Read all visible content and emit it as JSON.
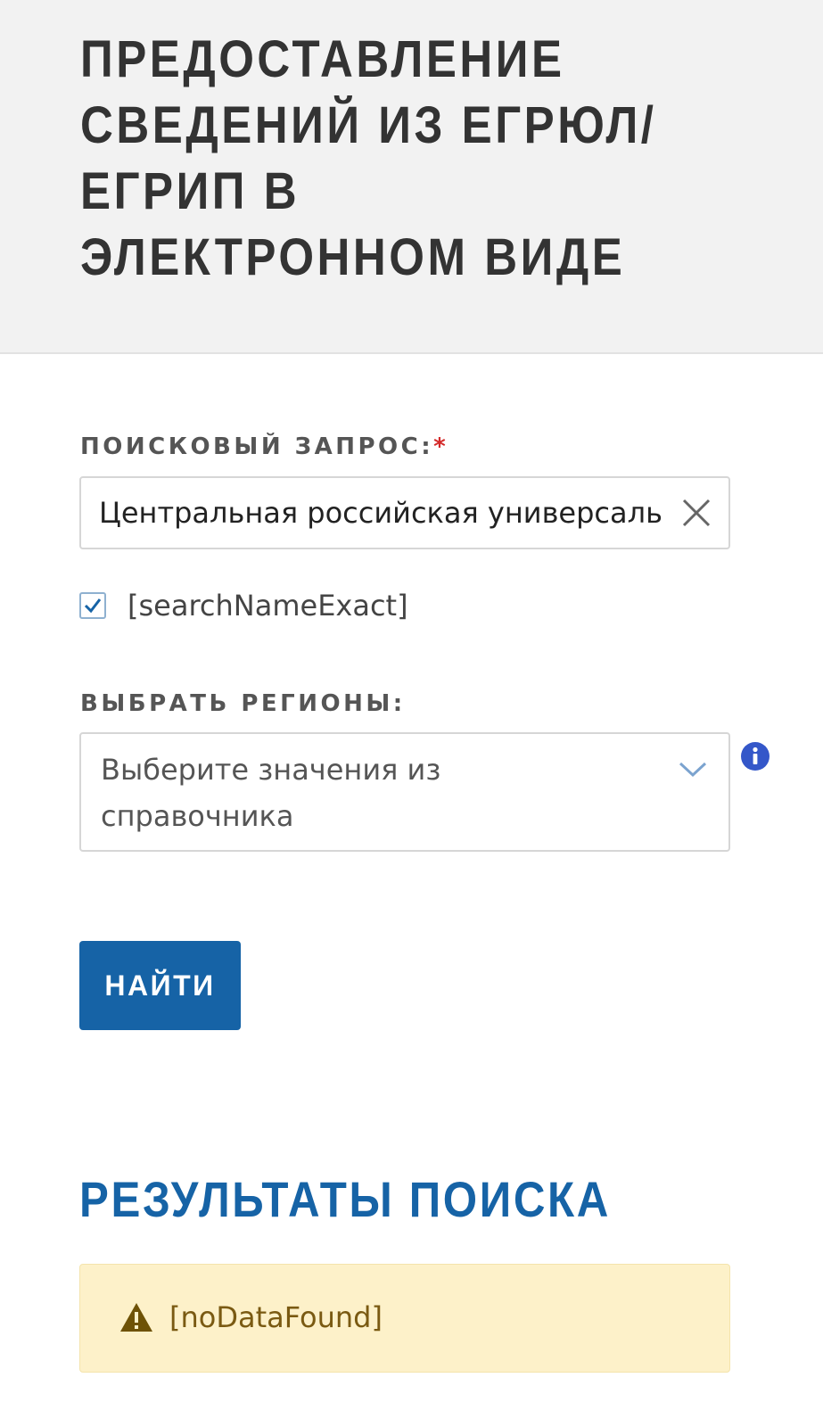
{
  "header": {
    "title": "Предоставление сведений из ЕГРЮЛ/ ЕГРИП в электронном виде"
  },
  "form": {
    "query_label": "Поисковый запрос:",
    "query_required_mark": "*",
    "query_value": "Центральная российская универсаль",
    "exact_checkbox_label": "[searchNameExact]",
    "exact_checked": true,
    "regions_label": "Выбрать регионы:",
    "regions_placeholder": "Выберите значения из справочника",
    "search_button": "Найти"
  },
  "results": {
    "title": "Результаты поиска",
    "message": "[noDataFound]"
  },
  "icons": {
    "clear": "close-icon",
    "checkbox": "check-icon",
    "dropdown": "chevron-down-icon",
    "info": "info-icon",
    "warning": "warning-icon"
  },
  "colors": {
    "accent": "#1663a6",
    "header_bg": "#f2f2f2",
    "required": "#d42a2a",
    "alert_bg": "#fdf1c9",
    "alert_text": "#7a5a12",
    "info_icon": "#3457c9"
  }
}
